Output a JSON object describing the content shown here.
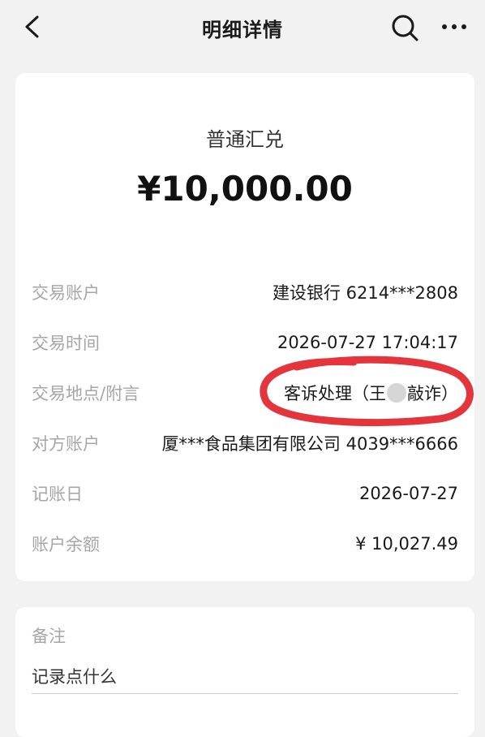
{
  "header": {
    "title": "明细详情"
  },
  "transaction": {
    "type": "普通汇兑",
    "amount": "¥10,000.00"
  },
  "details": [
    {
      "label": "交易账户",
      "value": "建设银行 6214***2808"
    },
    {
      "label": "交易时间",
      "value": "2026-07-27 17:04:17"
    },
    {
      "label": "交易地点/附言",
      "value_prefix": "客诉处理（王",
      "value_suffix": "敲诈）"
    },
    {
      "label": "对方账户",
      "value": "厦***食品集团有限公司 4039***6666"
    },
    {
      "label": "记账日",
      "value": "2026-07-27"
    },
    {
      "label": "账户余额",
      "value": "¥ 10,027.49"
    }
  ],
  "note": {
    "label": "备注",
    "placeholder": "记录点什么"
  },
  "colors": {
    "background": "#f2f2f2",
    "card": "#ffffff",
    "label": "#a6a6a6",
    "annotation": "#e3242b"
  },
  "icons": {
    "back": "chevron-left-icon",
    "search": "search-icon",
    "more": "more-dots-icon"
  }
}
